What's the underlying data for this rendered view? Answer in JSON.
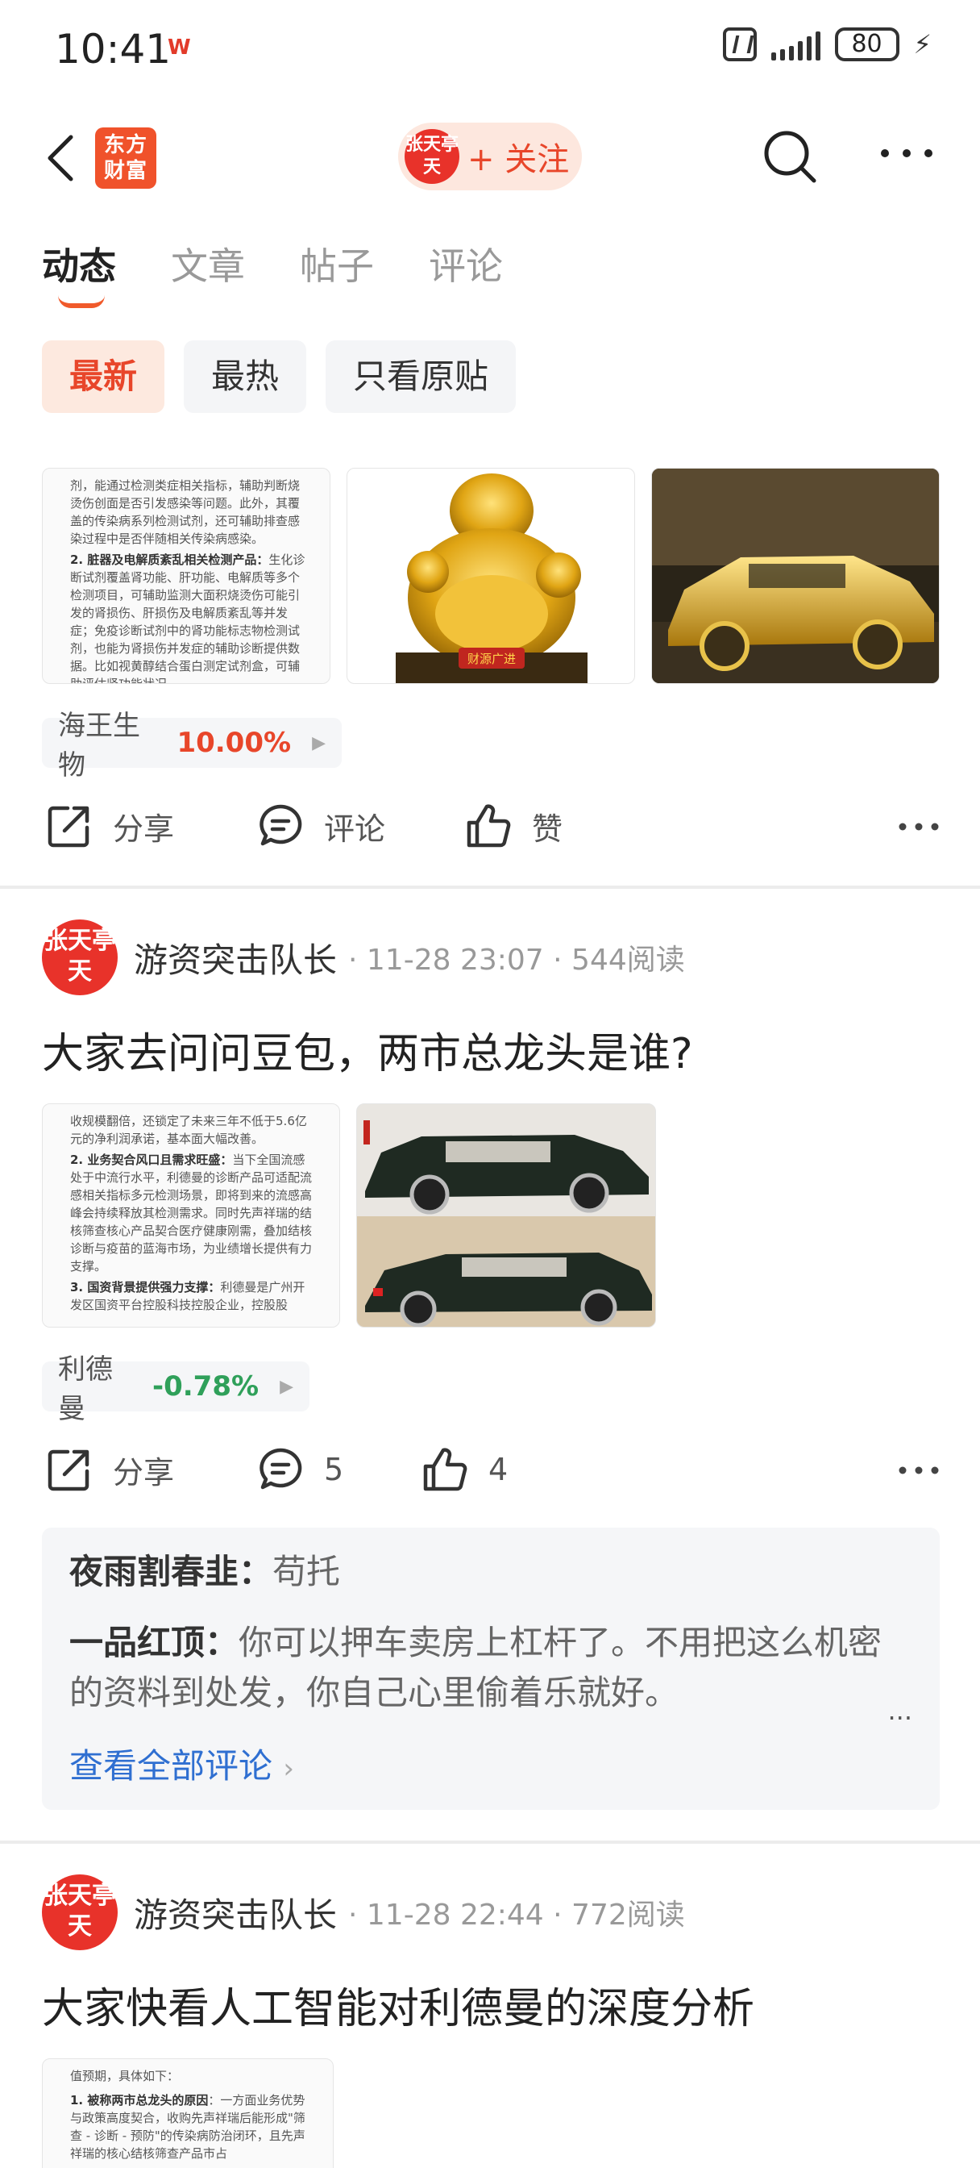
{
  "status_bar": {
    "time": "10:41",
    "app_badge": "W",
    "battery": "80"
  },
  "header": {
    "logo_text": "东方财富",
    "avatar_text": "张天亭天",
    "follow_label": "+ 关注"
  },
  "tabs": [
    {
      "label": "动态",
      "active": true
    },
    {
      "label": "文章",
      "active": false
    },
    {
      "label": "帖子",
      "active": false
    },
    {
      "label": "评论",
      "active": false
    }
  ],
  "filters": [
    {
      "label": "最新",
      "active": true
    },
    {
      "label": "最热",
      "active": false
    },
    {
      "label": "只看原贴",
      "active": false
    }
  ],
  "post1": {
    "doc_snippet": {
      "intro": "剂，能通过检测类症相关指标，辅助判断烧烫伤创面是否引发感染等问题。此外，其覆盖的传染病系列检测试剂，还可辅助排查感染过程中是否伴随相关传染病感染。",
      "item_title": "2. 脏器及电解质紊乱相关检测产品：",
      "item_body": "生化诊断试剂覆盖肾功能、肝功能、电解质等多个检测项目，可辅助监测大面积烧烫伤可能引发的肾损伤、肝损伤及电解质紊乱等并发症；免疫诊断试剂中的肾功能标志物检测试剂，也能为肾损伤并发症的辅助诊断提供数据。比如视黄醇结合蛋白测定试剂盒，可辅助评估肾功能状况。"
    },
    "buddha_caption": "财源广进",
    "stock": {
      "name": "海王生物",
      "change": "10.00%",
      "color": "#e8462a"
    },
    "actions": {
      "share": "分享",
      "comment": "评论",
      "like": "赞"
    }
  },
  "post2": {
    "author": "游资突击队长",
    "time": "11-28 23:07",
    "reads": "544阅读",
    "title": "大家去问问豆包，两市总龙头是谁?",
    "doc_snippet": {
      "intro": "收规模翻倍，还锁定了未来三年不低于5.6亿元的净利润承诺，基本面大幅改善。",
      "item1_title": "2. 业务契合风口且需求旺盛：",
      "item1_body": "当下全国流感处于中流行水平，利德曼的诊断产品可适配流感相关指标多元检测场景，即将到来的流感高峰会持续释放其检测需求。同时先声祥瑞的结核筛查核心产品契合医疗健康刚需，叠加结核诊断与疫苗的蓝海市场，为业绩增长提供有力支撑。",
      "item2_title": "3. 国资背景提供强力支撑：",
      "item2_body": "利德曼是广州开发区国资平台控股科技控股企业，控股股"
    },
    "stock": {
      "name": "利德曼",
      "change": "-0.78%",
      "color": "#2fa05a"
    },
    "actions": {
      "share": "分享",
      "comment": "5",
      "like": "4"
    },
    "comments": [
      {
        "user": "夜雨割春韭：",
        "text": "苟托"
      },
      {
        "user": "一品红顶：",
        "text": "你可以押车卖房上杠杆了。不用把这么机密的资料到处发，你自己心里偷着乐就好。"
      }
    ],
    "comment_more": "...",
    "view_all": "查看全部评论"
  },
  "post3": {
    "author": "游资突击队长",
    "time": "11-28 22:44",
    "reads": "772阅读",
    "title": "大家快看人工智能对利德曼的深度分析",
    "doc_snippet": {
      "intro": "值预期，具体如下：",
      "item_title": "1. 被称两市总龙头的原因",
      "item_body": "：一方面业务优势与政策高度契合，收购先声祥瑞后能形成\"筛查 - 诊断 - 预防\"的传染病防治闭环，且先声祥瑞的核心结核筛查产品市占"
    }
  },
  "colors": {
    "accent": "#e8462a",
    "link": "#2f6fd1",
    "up": "#e8462a",
    "down": "#2fa05a"
  }
}
